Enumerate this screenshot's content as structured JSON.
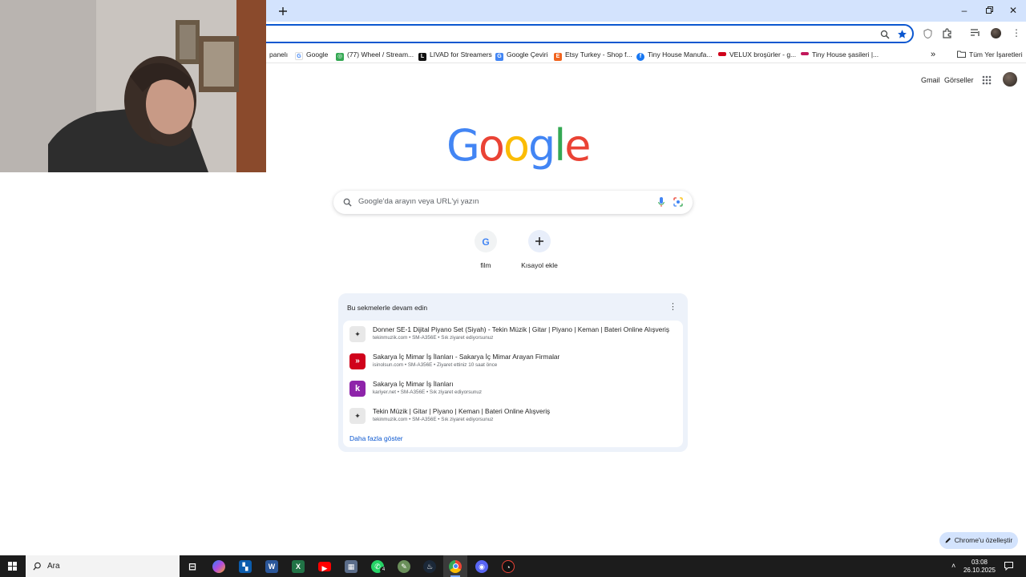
{
  "browser": {
    "new_tab_icon": "plus-icon",
    "omnibox_value": "",
    "bookmarks": [
      {
        "label": "panelı",
        "icon": "bookmark-favicon",
        "color": "#888888"
      },
      {
        "label": "Google",
        "icon": "google-g-icon",
        "color": "#4285f4"
      },
      {
        "label": "(77) Wheel / Stream...",
        "icon": "wheel-icon",
        "color": "#34a853"
      },
      {
        "label": "LIVAD for Streamers",
        "icon": "livad-icon",
        "color": "#111111"
      },
      {
        "label": "Google Çeviri",
        "icon": "translate-icon",
        "color": "#4285f4"
      },
      {
        "label": "Etsy Turkey - Shop f...",
        "icon": "etsy-icon",
        "color": "#f1641e"
      },
      {
        "label": "Tiny House Manufa...",
        "icon": "facebook-icon",
        "color": "#1877f2"
      },
      {
        "label": "VELUX broşürler - g...",
        "icon": "velux-icon",
        "color": "#d0021b"
      },
      {
        "label": "Tiny House şasileri |...",
        "icon": "site-icon",
        "color": "#c2185b"
      }
    ],
    "all_bookmarks_label": "Tüm Yer İşaretleri"
  },
  "google": {
    "gmail": "Gmail",
    "images": "Görseller",
    "logo_letters": [
      {
        "ch": "G",
        "color": "#4285f4"
      },
      {
        "ch": "o",
        "color": "#ea4335"
      },
      {
        "ch": "o",
        "color": "#fbbc05"
      },
      {
        "ch": "g",
        "color": "#4285f4"
      },
      {
        "ch": "l",
        "color": "#34a853"
      },
      {
        "ch": "e",
        "color": "#ea4335"
      }
    ],
    "search_placeholder": "Google'da arayın veya URL'yi yazın",
    "shortcuts": [
      {
        "label": "film",
        "icon": "google-g-icon"
      },
      {
        "label": "Kısayol ekle",
        "icon": "plus-icon"
      }
    ],
    "continue_card": {
      "title": "Bu sekmelerle devam edin",
      "rows": [
        {
          "title": "Donner SE-1 Dijital Piyano Set (Siyah) - Tekin Müzik | Gitar | Piyano | Keman | Bateri Online Alışveriş",
          "sub": "tekinmuzik.com • SM-A356E • Sık ziyaret ediyorsunuz",
          "icon": "tekin-muzik-icon",
          "color": "#e8e8e8"
        },
        {
          "title": "Sakarya İç Mimar İş İlanları - Sakarya İç Mimar Arayan Firmalar",
          "sub": "isinolsun.com • SM-A356E • Ziyaret ettiniz 10 saat önce",
          "icon": "isinolsun-icon",
          "color": "#d0021b"
        },
        {
          "title": "Sakarya İç Mimar İş İlanları",
          "sub": "kariyer.net • SM-A356E • Sık ziyaret ediyorsunuz",
          "icon": "kariyer-icon",
          "color": "#8e24aa"
        },
        {
          "title": "Tekin Müzik | Gitar | Piyano | Keman | Bateri Online Alışveriş",
          "sub": "tekinmuzik.com • SM-A356E • Sık ziyaret ediyorsunuz",
          "icon": "tekin-muzik-icon",
          "color": "#e8e8e8"
        }
      ],
      "show_more": "Daha fazla göster"
    },
    "customize": "Chrome'u özelleştir"
  },
  "taskbar": {
    "search_placeholder": "Ara",
    "whatsapp_badge": "4",
    "time": "03:08",
    "date": "26.10.2025"
  }
}
